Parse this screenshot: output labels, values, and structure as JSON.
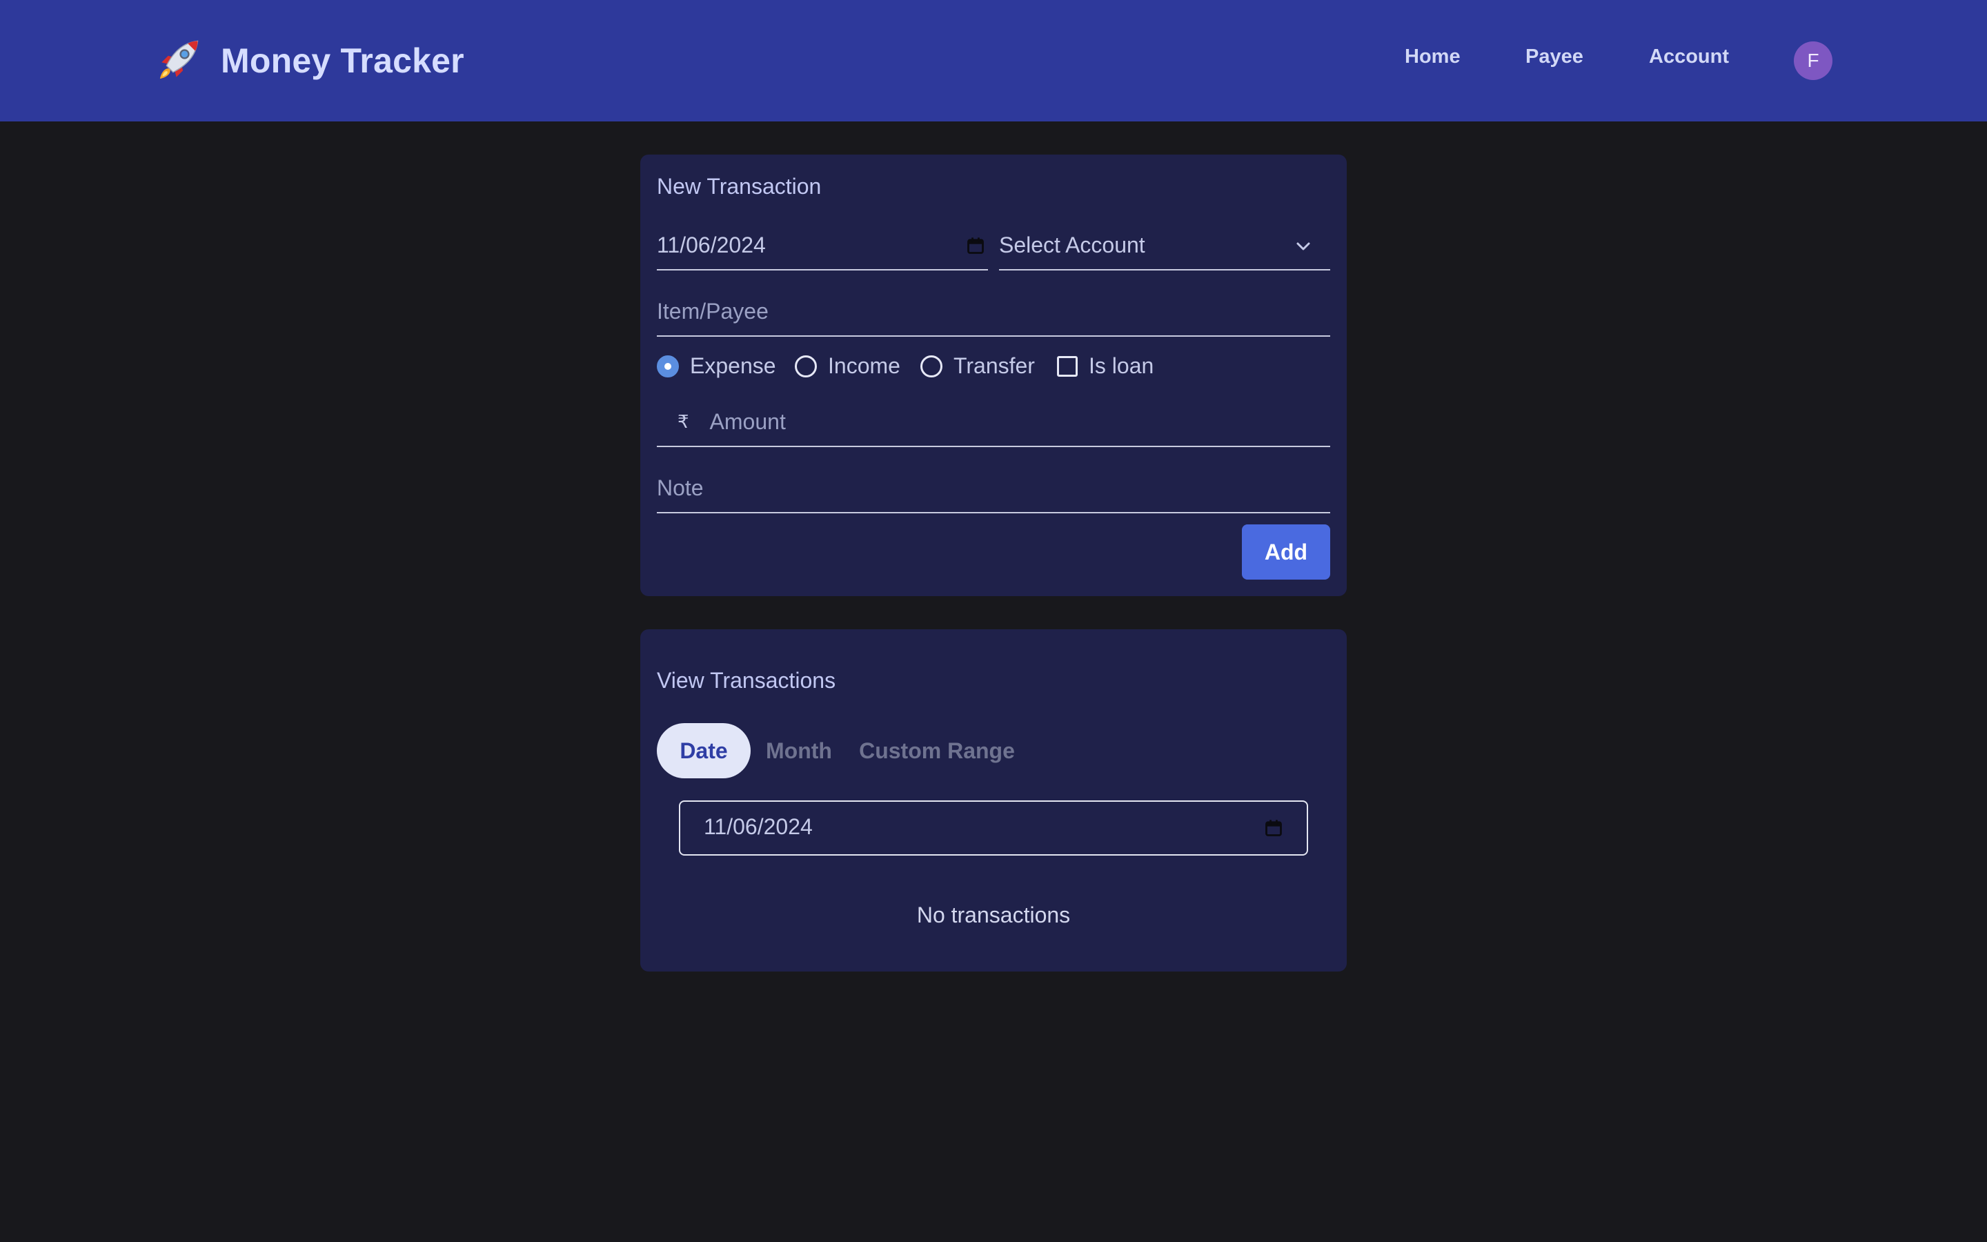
{
  "header": {
    "title": "Money Tracker",
    "logo_icon": "rocket-icon",
    "nav": [
      "Home",
      "Payee",
      "Account"
    ],
    "avatar_initial": "F",
    "colors": {
      "bar": "#2e399b",
      "avatar": "#7e57c2"
    }
  },
  "new_transaction": {
    "title": "New Transaction",
    "date_value": "11/06/2024",
    "account_placeholder": "Select Account",
    "payee_placeholder": "Item/Payee",
    "type_options": [
      {
        "label": "Expense",
        "selected": true
      },
      {
        "label": "Income",
        "selected": false
      },
      {
        "label": "Transfer",
        "selected": false
      }
    ],
    "loan_label": "Is loan",
    "loan_checked": false,
    "currency_symbol": "₹",
    "amount_placeholder": "Amount",
    "note_placeholder": "Note",
    "add_label": "Add"
  },
  "view_transactions": {
    "title": "View Transactions",
    "tabs": [
      "Date",
      "Month",
      "Custom Range"
    ],
    "active_tab": "Date",
    "date_value": "11/06/2024",
    "empty_message": "No transactions"
  },
  "colors": {
    "background": "#18181c",
    "card": "#1f214a",
    "accent": "#4a6ae0"
  }
}
